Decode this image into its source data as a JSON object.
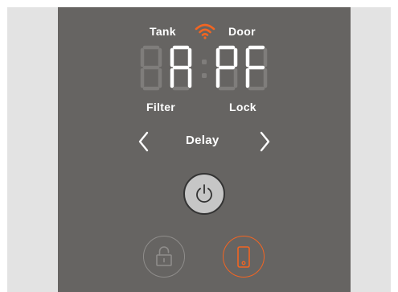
{
  "labels": {
    "tank": "Tank",
    "door": "Door",
    "filter": "Filter",
    "lock": "Lock"
  },
  "display": {
    "text": "8A:PF",
    "dim_segments_visible": true
  },
  "delay": {
    "label": "Delay"
  },
  "icons": {
    "wifi": "wifi-icon",
    "prev": "chevron-left-icon",
    "next": "chevron-right-icon",
    "power": "power-icon",
    "child_lock": "padlock-open-icon",
    "remote": "phone-remote-icon"
  },
  "colors": {
    "panel": "#666462",
    "side": "#e3e3e3",
    "accent": "#f26522",
    "text": "#ffffff",
    "segment_dim": "#7f7d7b",
    "power_button": "#c6c6c6"
  }
}
